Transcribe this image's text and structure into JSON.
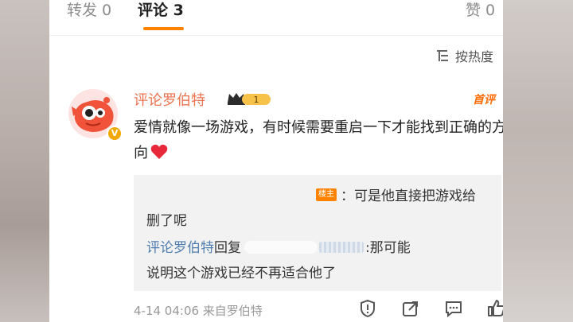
{
  "tabs": {
    "repost": "转发 0",
    "comment": "评论 3",
    "like": "赞 0"
  },
  "sort_label": "按热度",
  "comment": {
    "username": "评论罗伯特",
    "level_badge": "1",
    "top_tag": "首评",
    "text": "爱情就像一场游戏，有时候需要重启一下才能找到正确的方向"
  },
  "replies": {
    "r1_tag": "楼主",
    "r1_first": "：可是他直接把游戏给",
    "r1_second": "删了呢",
    "r2_user": "评论罗伯特",
    "r2_reply_word": "回复",
    "r2_colon_text": ":那可能",
    "r2_second": "说明这个游戏已经不再适合他了"
  },
  "footer": {
    "meta": "4-14 04:06 来自罗伯特"
  },
  "colors": {
    "accent": "#ff8200",
    "username": "#eb7350",
    "link": "#507daf"
  },
  "icons": [
    "sort-icon",
    "avatar",
    "crown-icon",
    "heart-icon",
    "report-icon",
    "share-icon",
    "comment-icon",
    "like-icon"
  ]
}
